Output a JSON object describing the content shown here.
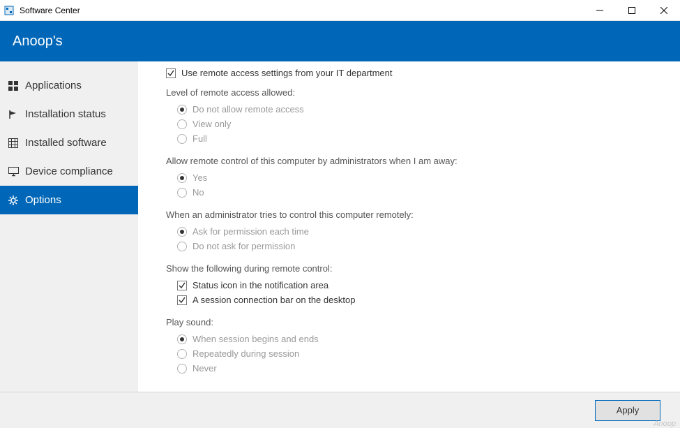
{
  "window": {
    "title": "Software Center"
  },
  "header": {
    "title": "Anoop's"
  },
  "sidebar": {
    "items": [
      {
        "label": "Applications"
      },
      {
        "label": "Installation status"
      },
      {
        "label": "Installed software"
      },
      {
        "label": "Device compliance"
      },
      {
        "label": "Options"
      }
    ]
  },
  "content": {
    "useRemoteLabel": "Use remote access settings from your IT department",
    "levelLabel": "Level of remote access allowed:",
    "levelOptions": {
      "noAllow": "Do not allow remote access",
      "viewOnly": "View only",
      "full": "Full"
    },
    "awayLabel": "Allow remote control of this computer by administrators when I am away:",
    "awayOptions": {
      "yes": "Yes",
      "no": "No"
    },
    "adminTriesLabel": "When an administrator tries to control this computer remotely:",
    "adminOptions": {
      "ask": "Ask for permission each time",
      "noAsk": "Do not ask for permission"
    },
    "showLabel": "Show the following during remote control:",
    "showOptions": {
      "statusIcon": "Status icon in the notification area",
      "sessionBar": "A session connection bar on the desktop"
    },
    "soundLabel": "Play sound:",
    "soundOptions": {
      "beginEnd": "When session begins and ends",
      "repeat": "Repeatedly during session",
      "never": "Never"
    }
  },
  "footer": {
    "apply": "Apply",
    "watermark": "Anoop"
  }
}
